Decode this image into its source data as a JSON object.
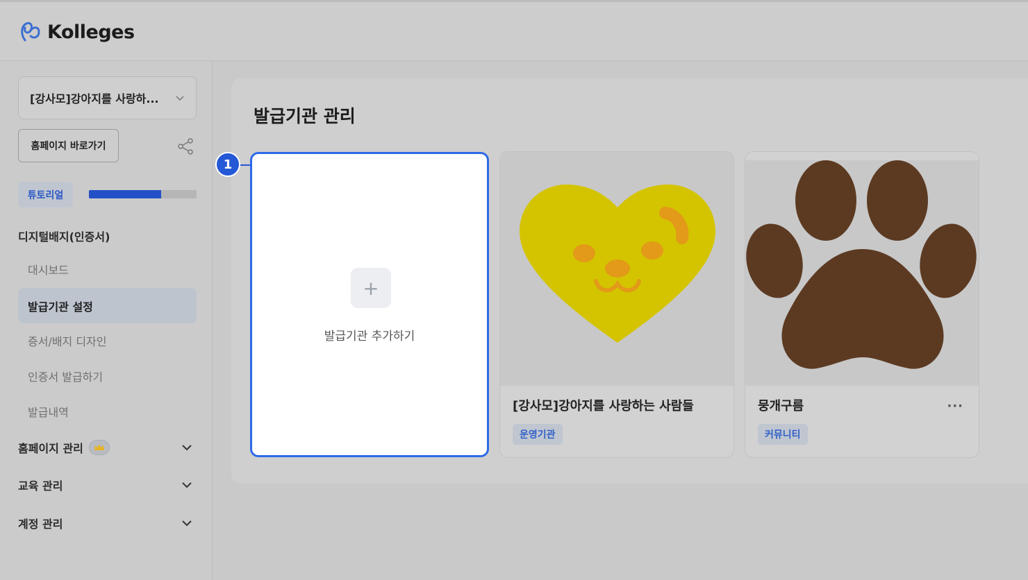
{
  "app": {
    "name": "Kolleges"
  },
  "sidebar": {
    "org_select": "[강사모]강아지를 사랑하...",
    "home_button": "홈페이지 바로가기",
    "tutorial": {
      "label": "튜토리얼",
      "progress_percent": 67
    },
    "section_title": "디지털배지(인증서)",
    "items": [
      {
        "label": "대시보드",
        "active": false
      },
      {
        "label": "발급기관 설정",
        "active": true
      },
      {
        "label": "증서/배지 디자인",
        "active": false
      },
      {
        "label": "인증서 발급하기",
        "active": false
      },
      {
        "label": "발급내역",
        "active": false
      }
    ],
    "groups": [
      {
        "label": "홈페이지 관리"
      },
      {
        "label": "교육 관리"
      },
      {
        "label": "계정 관리"
      }
    ]
  },
  "main": {
    "title": "발급기관 관리",
    "add_card": {
      "label": "발급기관 추가하기",
      "marker": "1"
    },
    "cards": [
      {
        "name": "[강사모]강아지를 사랑하는 사람들",
        "tag": "운영기관",
        "image": "yellow-heart-dog-logo"
      },
      {
        "name": "뭉개구름",
        "tag": "커뮤니티",
        "image": "brown-paw-print",
        "more": "···"
      }
    ]
  },
  "colors": {
    "accent": "#2d6ae8",
    "tag_text": "#3160c8",
    "progress": "#2350c6"
  }
}
